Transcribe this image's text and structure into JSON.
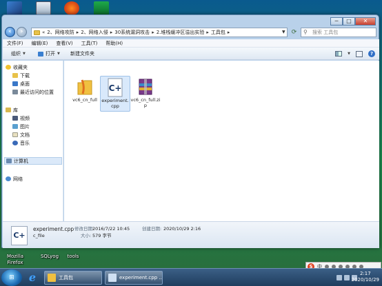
{
  "desktop": {
    "bottom_labels": [
      "Mozilla Firefox",
      "SQLyog",
      "tools"
    ]
  },
  "window": {
    "controls": {
      "minimize": "─",
      "maximize": "□",
      "close": "✕"
    },
    "address": {
      "crumbs": [
        "«",
        "2、网络攻防",
        "2、网络入侵",
        "30系统漏洞攻击",
        "2.堆栈缓冲区溢出实验",
        "工具包"
      ],
      "search_placeholder": "搜索 工具包"
    },
    "menu": [
      "文件(F)",
      "编辑(E)",
      "查看(V)",
      "工具(T)",
      "帮助(H)"
    ],
    "toolbar": {
      "organize": "组织",
      "open": "打开",
      "new_folder": "新建文件夹"
    },
    "nav": {
      "favorites": "收藏夹",
      "favorites_items": [
        "下载",
        "桌面",
        "最近访问的位置"
      ],
      "libraries": "库",
      "library_items": [
        "视频",
        "图片",
        "文档",
        "音乐"
      ],
      "computer": "计算机",
      "network": "网络"
    },
    "files": [
      {
        "name": "vc6_cn_full",
        "icon": "folder-icon"
      },
      {
        "name": "experiment.cpp",
        "icon": "cpp-file-icon"
      },
      {
        "name": "vc6_cn_full.zip",
        "icon": "zip-archive-icon"
      }
    ],
    "details": {
      "filename": "experiment.cpp",
      "type": "c_file",
      "modified_label": "修改日期:",
      "modified": "2016/7/22 10:45",
      "created_label": "创建日期:",
      "created": "2020/10/29 2:16",
      "size_label": "大小:",
      "size": "579 字节"
    }
  },
  "taskbar": {
    "buttons": [
      "工具包",
      "experiment.cpp ..."
    ],
    "clock_time": "2:17",
    "clock_date": "2020/10/29",
    "ime_label": "中"
  }
}
